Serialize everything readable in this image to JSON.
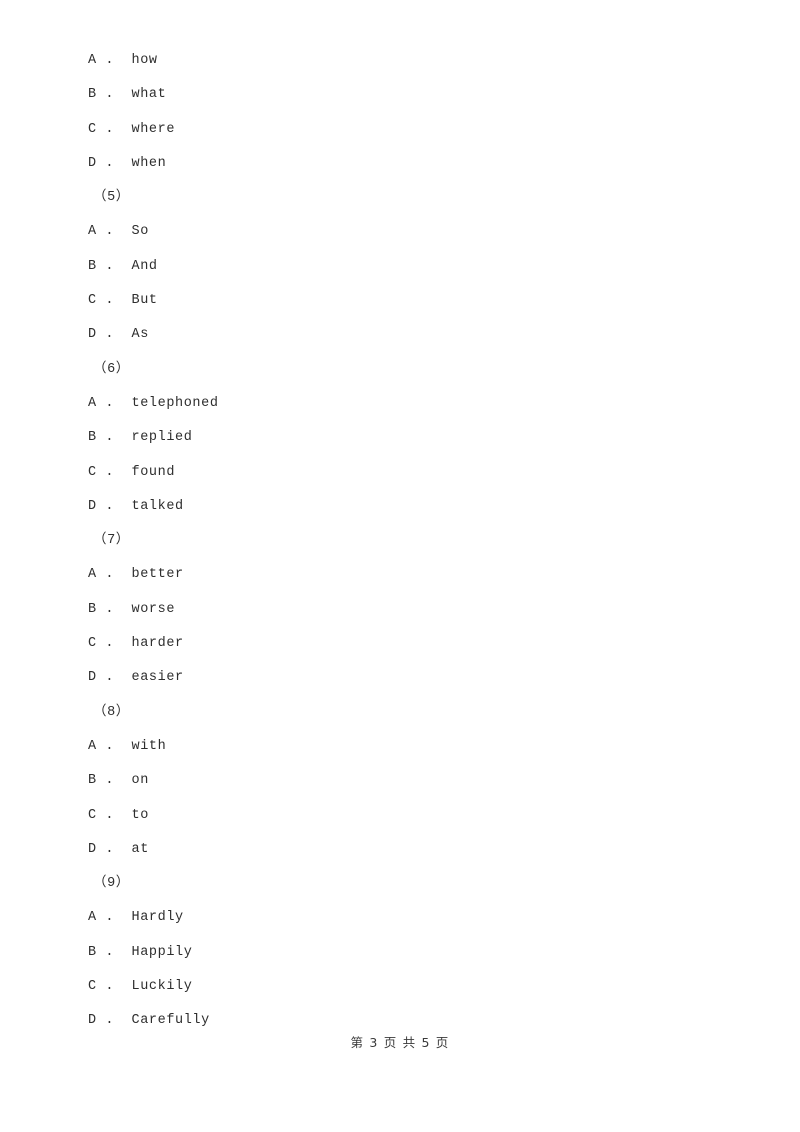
{
  "document": {
    "page_label": "第 3 页 共 5 页",
    "page_number": "3",
    "total_pages": "5",
    "text_color": "#2e2e2e",
    "background_color": "#ffffff"
  },
  "blocks": [
    {
      "type": "options",
      "separator": " .  ",
      "items": [
        {
          "letter": "A",
          "text": "how"
        },
        {
          "letter": "B",
          "text": "what"
        },
        {
          "letter": "C",
          "text": "where"
        },
        {
          "letter": "D",
          "text": "when"
        }
      ]
    },
    {
      "type": "question_number",
      "label": "（5）"
    },
    {
      "type": "options",
      "separator": " .  ",
      "items": [
        {
          "letter": "A",
          "text": "So"
        },
        {
          "letter": "B",
          "text": "And"
        },
        {
          "letter": "C",
          "text": "But"
        },
        {
          "letter": "D",
          "text": "As"
        }
      ]
    },
    {
      "type": "question_number",
      "label": "（6）"
    },
    {
      "type": "options",
      "separator": " .  ",
      "items": [
        {
          "letter": "A",
          "text": "telephoned"
        },
        {
          "letter": "B",
          "text": "replied"
        },
        {
          "letter": "C",
          "text": "found"
        },
        {
          "letter": "D",
          "text": "talked"
        }
      ]
    },
    {
      "type": "question_number",
      "label": "（7）"
    },
    {
      "type": "options",
      "separator": " .  ",
      "items": [
        {
          "letter": "A",
          "text": "better"
        },
        {
          "letter": "B",
          "text": "worse"
        },
        {
          "letter": "C",
          "text": "harder"
        },
        {
          "letter": "D",
          "text": "easier"
        }
      ]
    },
    {
      "type": "question_number",
      "label": "（8）"
    },
    {
      "type": "options",
      "separator": " .  ",
      "items": [
        {
          "letter": "A",
          "text": "with"
        },
        {
          "letter": "B",
          "text": "on"
        },
        {
          "letter": "C",
          "text": "to"
        },
        {
          "letter": "D",
          "text": "at"
        }
      ]
    },
    {
      "type": "question_number",
      "label": "（9）"
    },
    {
      "type": "options",
      "separator": " .  ",
      "items": [
        {
          "letter": "A",
          "text": "Hardly"
        },
        {
          "letter": "B",
          "text": "Happily"
        },
        {
          "letter": "C",
          "text": "Luckily"
        },
        {
          "letter": "D",
          "text": "Carefully"
        }
      ]
    }
  ]
}
